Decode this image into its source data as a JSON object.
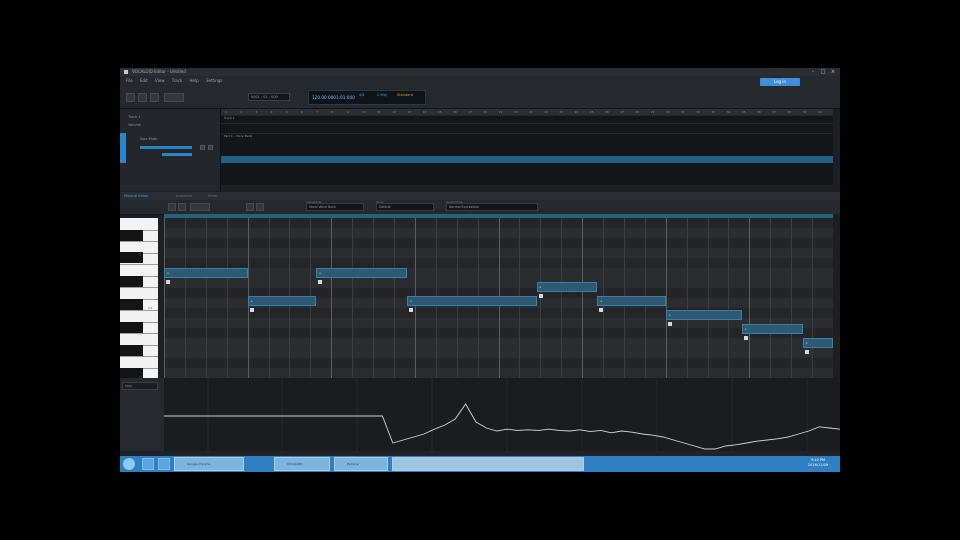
{
  "window": {
    "title": "VOCALOID Editor - Untitled"
  },
  "menu": [
    "File",
    "Edit",
    "View",
    "Track",
    "Help",
    "Settings"
  ],
  "account": {
    "login_label": "Log in"
  },
  "toolbar": {
    "position_field": "0001 : 01 : 000"
  },
  "transport": {
    "tempo": "120.00 0001:01:000",
    "time_signature": "4/4",
    "key": "C Maj",
    "mode": "Standard"
  },
  "tracks": {
    "header": "Track 1",
    "subheader": "Volume",
    "row_label": "Solo Mute"
  },
  "arrangement": {
    "ruler_numbers": [
      "1",
      "2",
      "3",
      "4",
      "5",
      "6",
      "7",
      "8",
      "9",
      "10",
      "11",
      "12",
      "13",
      "14",
      "15",
      "16",
      "17",
      "18",
      "19",
      "20",
      "21",
      "22",
      "23",
      "24",
      "25",
      "26",
      "27",
      "28",
      "29",
      "30",
      "31",
      "32",
      "33",
      "34",
      "35",
      "36",
      "37",
      "38",
      "39",
      "40"
    ],
    "lane_label": "Track 1",
    "part_label": "Part 1 - Voice Bank"
  },
  "panels": {
    "editor_title": "Musical Editor",
    "tab_2": "Inspector",
    "tab_3": "Mixer"
  },
  "piano_roll": {
    "fields": [
      {
        "label": "Voicebank",
        "value": "Vocal Voice Bank"
      },
      {
        "label": "Style",
        "value": "Default"
      },
      {
        "label": "Vocal Style",
        "value": "Normal Expression"
      }
    ],
    "keyboard_label": "C4",
    "notes": [
      {
        "lyric": "a",
        "start": 0,
        "length": 11,
        "pitch": 9
      },
      {
        "lyric": "a",
        "start": 11,
        "length": 9,
        "pitch": 7
      },
      {
        "lyric": "a",
        "start": 20,
        "length": 12,
        "pitch": 9
      },
      {
        "lyric": "a",
        "start": 32,
        "length": 17,
        "pitch": 7
      },
      {
        "lyric": "a",
        "start": 49,
        "length": 8,
        "pitch": 8
      },
      {
        "lyric": "a",
        "start": 57,
        "length": 9,
        "pitch": 7
      },
      {
        "lyric": "a",
        "start": 66,
        "length": 10,
        "pitch": 6
      },
      {
        "lyric": "a",
        "start": 76,
        "length": 8,
        "pitch": 5
      },
      {
        "lyric": "a",
        "start": 84,
        "length": 4,
        "pitch": 4
      }
    ]
  },
  "parameter": {
    "selector": "Pitch",
    "curve": [
      0.6,
      0.6,
      0.6,
      0.6,
      0.6,
      0.6,
      0.6,
      0.6,
      0.6,
      0.6,
      0.6,
      0.6,
      0.6,
      0.6,
      0.6,
      0.6,
      0.6,
      0.6,
      0.6,
      0.6,
      0.6,
      0.6,
      0.15,
      0.2,
      0.25,
      0.3,
      0.38,
      0.45,
      0.55,
      0.8,
      0.5,
      0.4,
      0.35,
      0.38,
      0.36,
      0.37,
      0.36,
      0.38,
      0.36,
      0.35,
      0.37,
      0.34,
      0.36,
      0.32,
      0.35,
      0.33,
      0.3,
      0.28,
      0.25,
      0.2,
      0.15,
      0.1,
      0.05,
      0.05,
      0.1,
      0.12,
      0.15,
      0.18,
      0.2,
      0.22,
      0.25,
      0.3,
      0.35,
      0.42,
      0.4,
      0.38
    ]
  },
  "taskbar": {
    "windows": [
      "Google Chrome",
      "VOCALOID",
      "Explorer"
    ],
    "clock_time": "9:40 PM",
    "clock_date": "2016/11/09"
  }
}
